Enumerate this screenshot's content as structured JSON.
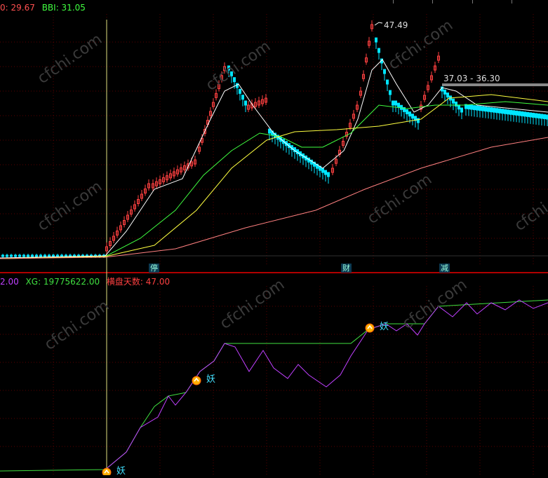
{
  "upper_header": {
    "ma_value": "0: 29.67",
    "bbi_label": "BBI: 31.05"
  },
  "lower_header": {
    "prefix": "2.00",
    "xg_label": "XG: 19775622.00",
    "hp_label": "横盘天数: 47.00"
  },
  "annotations": {
    "high_price": "47.49",
    "range_label": "37.03 - 36.30"
  },
  "event_tags": [
    {
      "label": "停"
    },
    {
      "label": "财"
    },
    {
      "label": "减"
    }
  ],
  "signal_labels": [
    {
      "label": "妖"
    },
    {
      "label": "妖"
    },
    {
      "label": "妖"
    }
  ],
  "watermark": "cfchi.com",
  "colors": {
    "up": "#ff4040",
    "down": "#00e5ff",
    "ma5": "#ffffff",
    "ma10": "#ffff40",
    "ma20": "#40ff40",
    "ma60": "#ff8080",
    "green_line": "#40e040",
    "purple_line": "#c040ff",
    "cursor": "#e0e080",
    "grid": "#5a0000"
  }
}
